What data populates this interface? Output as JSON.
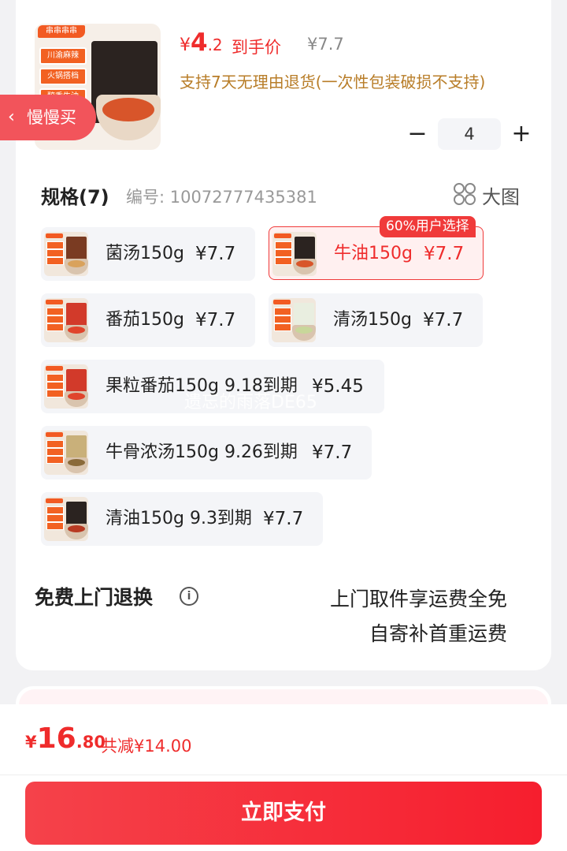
{
  "product": {
    "brand": "串串串串",
    "image_labels": [
      "川渝麻辣",
      "火锅搭档",
      "醇香牛油"
    ],
    "price_currency": "¥",
    "price_int": "4",
    "price_dec": ".2",
    "price_label": "到手价",
    "original_price": "¥7.7",
    "policy": "支持7天无理由退货(一次性包装破损不支持)"
  },
  "slow_buy": {
    "label": "慢慢买",
    "icon": "chevron-left-icon"
  },
  "stepper": {
    "minus": "−",
    "value": "4",
    "plus": "+"
  },
  "spec": {
    "title": "规格(7)",
    "sku": "编号: 10072777435381",
    "big_view_label": "大图",
    "badge": "60%用户选择",
    "options": [
      {
        "name": "菌汤150g",
        "price": "¥7.7",
        "selected": false,
        "pack_color": "#7a3b22",
        "broth_color": "#d9a25c"
      },
      {
        "name": "牛油150g",
        "price": "¥7.7",
        "selected": true,
        "pack_color": "#2b2320",
        "broth_color": "#d8552a"
      },
      {
        "name": "番茄150g",
        "price": "¥7.7",
        "selected": false,
        "pack_color": "#d23a2a",
        "broth_color": "#e0442c"
      },
      {
        "name": "清汤150g",
        "price": "¥7.7",
        "selected": false,
        "pack_color": "#e9eee0",
        "broth_color": "#c8d79a"
      },
      {
        "name": "果粒番茄150g 9.18到期",
        "price": "¥5.45",
        "selected": false,
        "pack_color": "#d23a2a",
        "broth_color": "#e0442c"
      },
      {
        "name": "牛骨浓汤150g 9.26到期",
        "price": "¥7.7",
        "selected": false,
        "pack_color": "#c9b07a",
        "broth_color": "#8a6a3a"
      },
      {
        "name": "清油150g 9.3到期",
        "price": "¥7.7",
        "selected": false,
        "pack_color": "#2b2320",
        "broth_color": "#b83a22"
      }
    ]
  },
  "watermark": "遗忘的雨落DE65",
  "free_return": {
    "title": "免费上门退换",
    "info_icon": "info-icon",
    "line1": "上门取件享运费全免",
    "line2": "自寄补首重运费"
  },
  "footer": {
    "currency": "¥",
    "total_int": "16",
    "total_dec": ".80",
    "saved": "共减¥14.00",
    "pay_label": "立即支付"
  },
  "colors": {
    "accent": "#ef2c2c",
    "policy": "#b87d28",
    "pay_button": "#f5424a"
  }
}
